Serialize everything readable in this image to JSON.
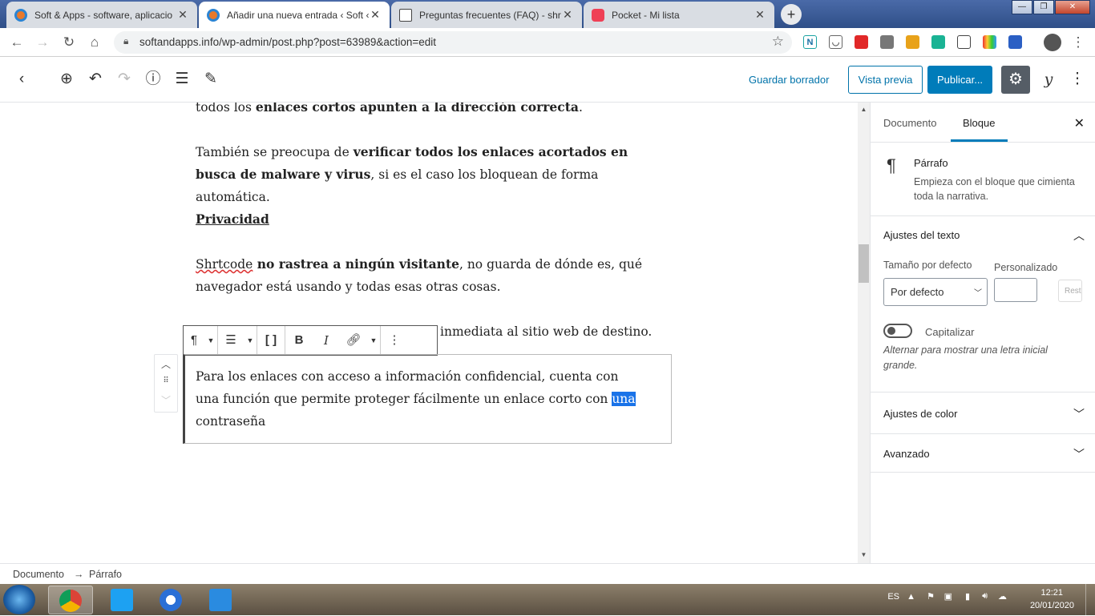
{
  "browser": {
    "tabs": [
      {
        "title": "Soft & Apps - software, aplicacio",
        "active": false,
        "favicon_color": "#2b84d3"
      },
      {
        "title": "Añadir una nueva entrada ‹ Soft ‹",
        "active": true,
        "favicon_color": "#2b84d3"
      },
      {
        "title": "Preguntas frecuentes (FAQ) - shrt",
        "active": false,
        "favicon_color": "#ffffff"
      },
      {
        "title": "Pocket - Mi lista",
        "active": false,
        "favicon_color": "#ef4056"
      }
    ],
    "close_glyph": "✕",
    "new_tab_glyph": "+",
    "url": "softandapps.info/wp-admin/post.php?post=63989&action=edit",
    "window_buttons": [
      "—",
      "❐",
      "✕"
    ]
  },
  "wp_toolbar": {
    "save_draft": "Guardar borrador",
    "preview": "Vista previa",
    "publish": "Publicar...",
    "yoast": "y"
  },
  "content": {
    "p1_prefix": "todos los ",
    "p1_bold": "enlaces cortos apunten a la dirección correcta",
    "p1_suffix": ".",
    "p2_prefix": "También se preocupa de ",
    "p2_bold": "verificar todos los enlaces acortados en busca de malware y virus",
    "p2_suffix": ", si es el caso los bloquean de forma automática.",
    "heading": "Privacidad",
    "p3_word": "Shrtcode",
    "p3_bold": " no rastrea a ningún visitante",
    "p3_suffix": ", no guarda de dónde es, qué navegador está usando y todas esas otras cosas.",
    "p4_visible": "inmediata al sitio web de destino.",
    "selected_prefix": "Para los enlaces con acceso a información confidencial, cuenta con una función que permite proteger fácilmente un enlace corto con ",
    "selected_highlight": "una",
    "selected_suffix": " contraseña"
  },
  "sidebar": {
    "tab_document": "Documento",
    "tab_block": "Bloque",
    "block_name": "Párrafo",
    "block_desc": "Empieza con el bloque que cimienta toda la narrativa.",
    "text_settings": "Ajustes del texto",
    "size_default_label": "Tamaño por defecto",
    "custom_label": "Personalizado",
    "size_select_value": "Por defecto",
    "reset_label": "Rest",
    "drop_cap": "Capitalizar",
    "drop_cap_help": "Alternar para mostrar una letra inicial grande.",
    "color_settings": "Ajustes de color",
    "advanced": "Avanzado"
  },
  "breadcrumb": {
    "doc": "Documento",
    "arrow": "→",
    "block": "Párrafo"
  },
  "taskbar": {
    "lang": "ES",
    "time": "12:21",
    "date": "20/01/2020"
  }
}
